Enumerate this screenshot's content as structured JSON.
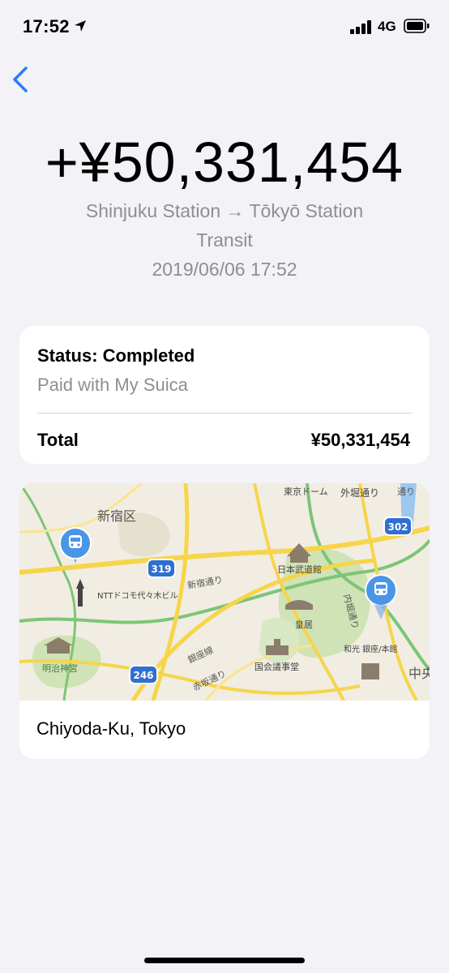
{
  "status_bar": {
    "time": "17:52",
    "network": "4G"
  },
  "header": {
    "amount": "+¥50,331,454",
    "route": "Shinjuku Station → Tōkyō Station",
    "category": "Transit",
    "datetime": "2019/06/06 17:52"
  },
  "status_card": {
    "status": "Status: Completed",
    "paid_with": "Paid with My Suica",
    "total_label": "Total",
    "total_value": "¥50,331,454"
  },
  "map_card": {
    "location": "Chiyoda-Ku, Tokyo",
    "labels": {
      "shinjuku_ku": "新宿区",
      "tokyo_dome": "東京ドーム",
      "sotobori": "外堀通り",
      "budokan": "日本武道館",
      "ntt": "NTTドコモ代々木ビル",
      "kokyo": "皇居",
      "meiji": "明治神宮",
      "kokkai": "国会議事堂",
      "wako": "和光 銀座/本館",
      "shinjuku_dori": "新宿通り",
      "ginza": "銀座線",
      "akasaka": "赤坂通り",
      "uchibori": "内堀通り",
      "route_319": "319",
      "route_246": "246",
      "route_302": "302",
      "chuo": "中央",
      "uchi": "通り"
    }
  }
}
